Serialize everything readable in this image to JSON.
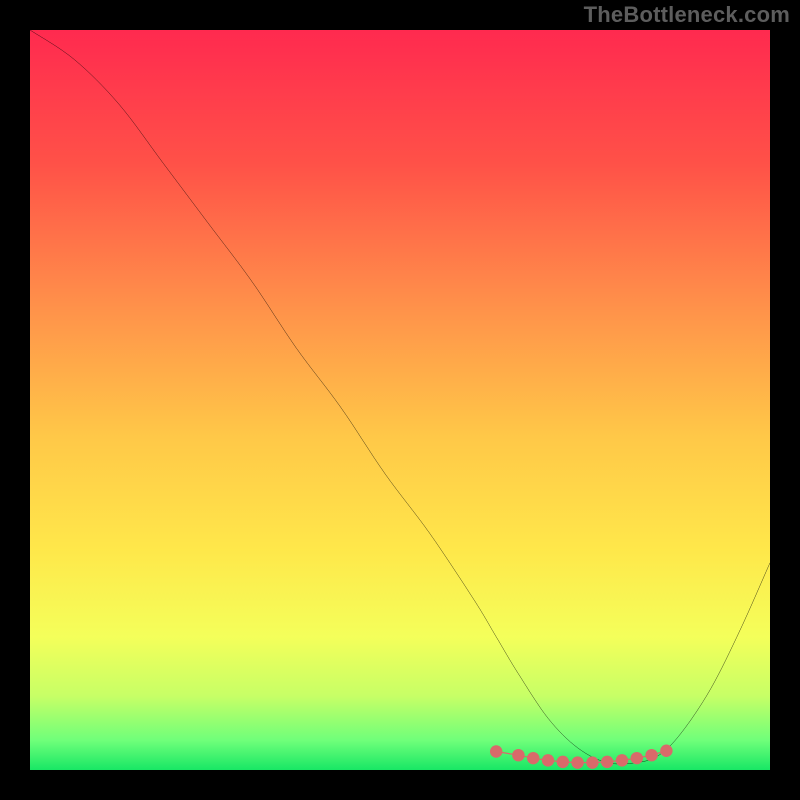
{
  "watermark": "TheBottleneck.com",
  "chart_data": {
    "type": "line",
    "title": "",
    "xlabel": "",
    "ylabel": "",
    "xlim": [
      0,
      100
    ],
    "ylim": [
      0,
      100
    ],
    "grid": false,
    "series": [
      {
        "name": "curve",
        "x": [
          0,
          6,
          12,
          18,
          24,
          30,
          36,
          42,
          48,
          54,
          60,
          63,
          66,
          70,
          74,
          78,
          82,
          85,
          88,
          92,
          96,
          100
        ],
        "values": [
          100,
          96,
          90,
          82,
          74,
          66,
          57,
          49,
          40,
          32,
          23,
          18,
          13,
          7,
          3,
          1,
          1,
          2,
          5,
          11,
          19,
          28
        ],
        "color": "#000000",
        "width": 2
      }
    ],
    "markers": {
      "name": "bottom-cluster",
      "x": [
        63,
        66,
        68,
        70,
        72,
        74,
        76,
        78,
        80,
        82,
        84,
        86
      ],
      "values": [
        2.5,
        2.0,
        1.6,
        1.3,
        1.1,
        1.0,
        1.0,
        1.1,
        1.3,
        1.6,
        2.0,
        2.6
      ],
      "color": "#d96a6a",
      "size": 7
    },
    "gradient_stops": [
      {
        "offset": 0.0,
        "color": "#ff2a4f"
      },
      {
        "offset": 0.18,
        "color": "#ff5148"
      },
      {
        "offset": 0.38,
        "color": "#ff934a"
      },
      {
        "offset": 0.55,
        "color": "#ffc848"
      },
      {
        "offset": 0.7,
        "color": "#ffe74a"
      },
      {
        "offset": 0.82,
        "color": "#f4ff5a"
      },
      {
        "offset": 0.9,
        "color": "#c7ff66"
      },
      {
        "offset": 0.96,
        "color": "#6fff7a"
      },
      {
        "offset": 1.0,
        "color": "#18e765"
      }
    ]
  }
}
